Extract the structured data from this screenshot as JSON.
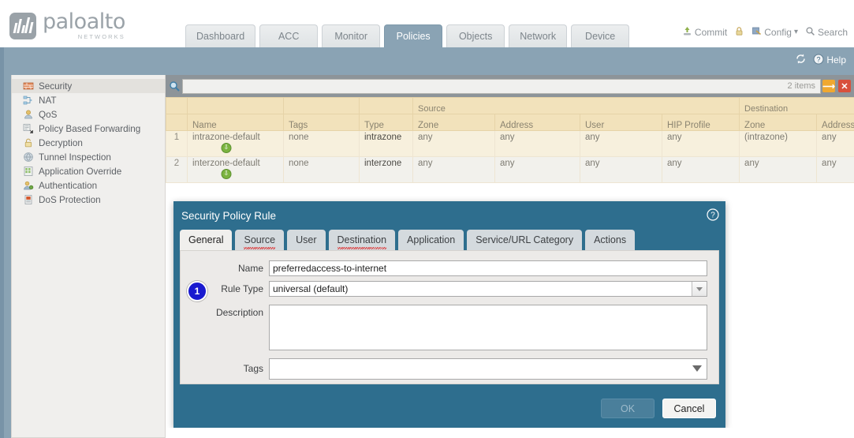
{
  "brand": {
    "name": "paloalto",
    "tagline": "NETWORKS",
    "logo_color": "#9aa2a8"
  },
  "nav": {
    "tabs": [
      {
        "label": "Dashboard",
        "active": false
      },
      {
        "label": "ACC",
        "active": false
      },
      {
        "label": "Monitor",
        "active": false
      },
      {
        "label": "Policies",
        "active": true
      },
      {
        "label": "Objects",
        "active": false
      },
      {
        "label": "Network",
        "active": false
      },
      {
        "label": "Device",
        "active": false
      }
    ],
    "active_tab": "Policies",
    "accent_color": "#8aa3b4"
  },
  "toplinks": [
    {
      "label": "Commit",
      "icon": "commit-icon"
    },
    {
      "label": "",
      "icon": "lock-icon"
    },
    {
      "label": "Config",
      "icon": "config-icon",
      "caret": "▾"
    },
    {
      "label": "Search",
      "icon": "search-icon"
    }
  ],
  "band": {
    "refresh_icon": "refresh-icon",
    "help_label": "Help",
    "help_icon": "help-icon"
  },
  "sidebar": {
    "items": [
      {
        "label": "Security",
        "icon": "firewall-icon",
        "selected": true
      },
      {
        "label": "NAT",
        "icon": "nat-icon",
        "selected": false
      },
      {
        "label": "QoS",
        "icon": "qos-icon",
        "selected": false
      },
      {
        "label": "Policy Based Forwarding",
        "icon": "pbf-icon",
        "selected": false
      },
      {
        "label": "Decryption",
        "icon": "lock-icon",
        "selected": false
      },
      {
        "label": "Tunnel Inspection",
        "icon": "tunnel-icon",
        "selected": false
      },
      {
        "label": "Application Override",
        "icon": "grid-icon",
        "selected": false
      },
      {
        "label": "Authentication",
        "icon": "user-key-icon",
        "selected": false
      },
      {
        "label": "DoS Protection",
        "icon": "dos-icon",
        "selected": false
      }
    ]
  },
  "search": {
    "value": "",
    "placeholder": "",
    "item_count": "2 items",
    "apply_icon": "arrow-right-icon",
    "clear_icon": "close-icon"
  },
  "rules_table": {
    "group_headers": [
      {
        "label": "Source",
        "span": 4
      },
      {
        "label": "Destination",
        "span": 2
      }
    ],
    "columns": [
      "",
      "Name",
      "Tags",
      "Type",
      "Zone",
      "Address",
      "User",
      "HIP Profile",
      "Zone",
      "Address"
    ],
    "rows": [
      {
        "num": "1",
        "name": "intrazone-default",
        "tags": "none",
        "type": "intrazone",
        "src_zone": "any",
        "src_address": "any",
        "src_user": "any",
        "hip_profile": "any",
        "dst_zone": "(intrazone)",
        "dst_address": "any"
      },
      {
        "num": "2",
        "name": "interzone-default",
        "tags": "none",
        "type": "interzone",
        "src_zone": "any",
        "src_address": "any",
        "src_user": "any",
        "hip_profile": "any",
        "dst_zone": "any",
        "dst_address": "any"
      }
    ],
    "header_bg": "#f2e2bb",
    "group_bg": "#e8d5aa"
  },
  "dialog": {
    "title": "Security Policy Rule",
    "help_icon": "help-icon",
    "accent_color": "#2e6e8e",
    "tabs": [
      {
        "label": "General",
        "active": true,
        "spellcheck_underline": false
      },
      {
        "label": "Source",
        "active": false,
        "spellcheck_underline": true
      },
      {
        "label": "User",
        "active": false,
        "spellcheck_underline": false
      },
      {
        "label": "Destination",
        "active": false,
        "spellcheck_underline": true
      },
      {
        "label": "Application",
        "active": false,
        "spellcheck_underline": false
      },
      {
        "label": "Service/URL Category",
        "active": false,
        "spellcheck_underline": false
      },
      {
        "label": "Actions",
        "active": false,
        "spellcheck_underline": false
      }
    ],
    "step_badge": "1",
    "fields": {
      "name_label": "Name",
      "name_value": "preferredaccess-to-internet",
      "name_placeholder": "",
      "ruletype_label": "Rule Type",
      "ruletype_value": "universal (default)",
      "description_label": "Description",
      "description_value": "",
      "description_placeholder": "",
      "tags_label": "Tags",
      "tags_value": "",
      "tags_placeholder": ""
    },
    "buttons": {
      "ok_label": "OK",
      "ok_disabled": true,
      "cancel_label": "Cancel"
    }
  }
}
